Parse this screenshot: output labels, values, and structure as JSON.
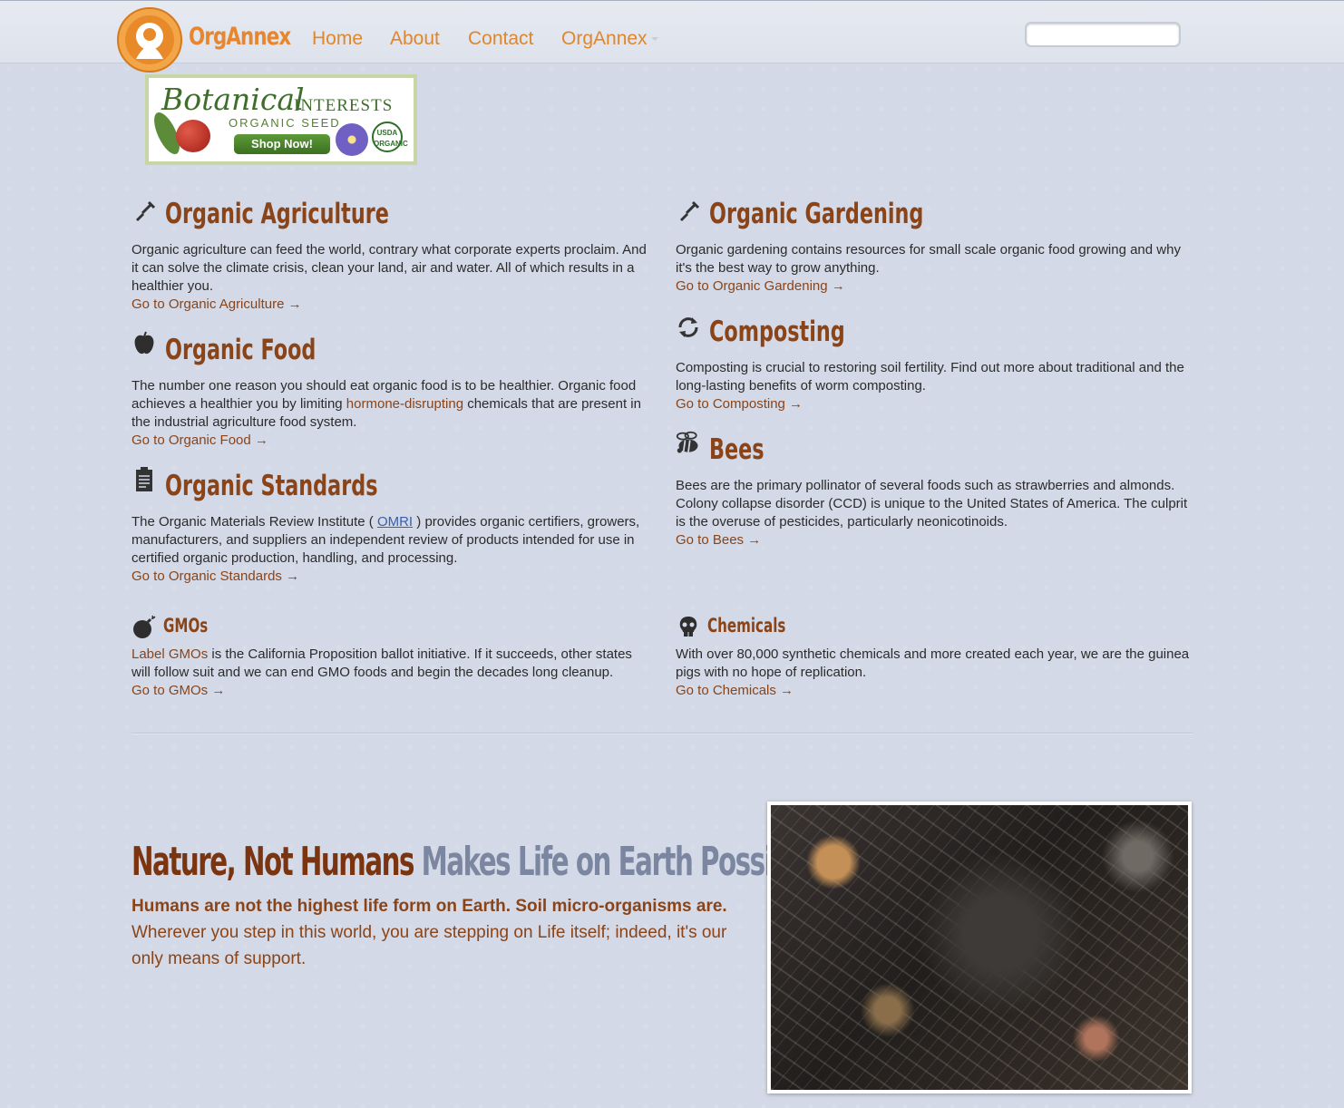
{
  "header": {
    "brand": "OrgAnnex",
    "nav": [
      {
        "label": "Home"
      },
      {
        "label": "About"
      },
      {
        "label": "Contact"
      },
      {
        "label": "OrgAnnex"
      }
    ],
    "search": {
      "placeholder": ""
    }
  },
  "banner": {
    "title": "Botanical",
    "title2": "INTERESTS",
    "subtitle": "ORGANIC SEED",
    "cta": "Shop Now!",
    "badge": "USDA ORGANIC"
  },
  "sections": {
    "agriculture": {
      "icon": "shovel-icon",
      "title": "Organic Agriculture",
      "text": "Organic agriculture can feed the world, contrary what corporate experts proclaim. And it can solve the climate crisis, clean your land, air and water. All of which results in a healthier you.",
      "link": "Go to Organic Agriculture →"
    },
    "food": {
      "icon": "apple-icon",
      "title": "Organic Food",
      "text_before": "The number one reason you should eat organic food is to be healthier. Organic food achieves a healthier you by limiting ",
      "text_link": "hormone-disrupting",
      "text_after": " chemicals that are present in the industrial agriculture food system.",
      "link": "Go to Organic Food →"
    },
    "standards": {
      "icon": "clipboard-icon",
      "title": "Organic Standards",
      "text_before": "The Organic Materials Review Institute ( ",
      "text_link": "OMRI",
      "text_after": " ) provides organic certifiers, growers, manufacturers, and suppliers an independent review of products intended for use in certified organic production, handling, and processing.",
      "link": "Go to Organic Standards →"
    },
    "gardening": {
      "icon": "shovel-icon",
      "title": "Organic Gardening",
      "text": "Organic gardening contains resources for small scale organic food growing and why it's the best way to grow anything.",
      "link": "Go to Organic Gardening →"
    },
    "composting": {
      "icon": "recycle-icon",
      "title": "Composting",
      "text": "Composting is crucial to restoring soil fertility. Find out more about traditional and the long-lasting benefits of worm composting.",
      "link": "Go to Composting →"
    },
    "bees": {
      "icon": "bee-icon",
      "title": "Bees",
      "text": "Bees are the primary pollinator of several foods such as strawberries and almonds. Colony collapse disorder (CCD) is unique to the United States of America. The culprit is the overuse of pesticides, particularly neonicotinoids.",
      "link": "Go to Bees →"
    },
    "gmos": {
      "icon": "bomb-icon",
      "title": "GMOs",
      "text_link": "Label GMOs",
      "text_after": " is the California Proposition ballot initiative. If it succeeds, other states will follow suit and we can end GMO foods and begin the decades long cleanup.",
      "link": "Go to GMOs →"
    },
    "chemicals": {
      "icon": "skull-icon",
      "title": "Chemicals",
      "text": "With over 80,000 synthetic chemicals and more created each year, we are the guinea pigs with no hope of replication.",
      "link": "Go to Chemicals →"
    }
  },
  "hero": {
    "title_a": "Nature, Not Humans",
    "title_b": "Makes Life on Earth Possible",
    "lead_bold": "Humans are not the highest life form on Earth. Soil micro-organisms are.",
    "lead_rest": " Wherever you step in this world, you are stepping on Life itself; indeed, it's our only means of support."
  },
  "colors": {
    "brand": "#e8862e",
    "heading": "#8a4418",
    "accent": "#7b86a0",
    "background": "#d3d9e6"
  }
}
